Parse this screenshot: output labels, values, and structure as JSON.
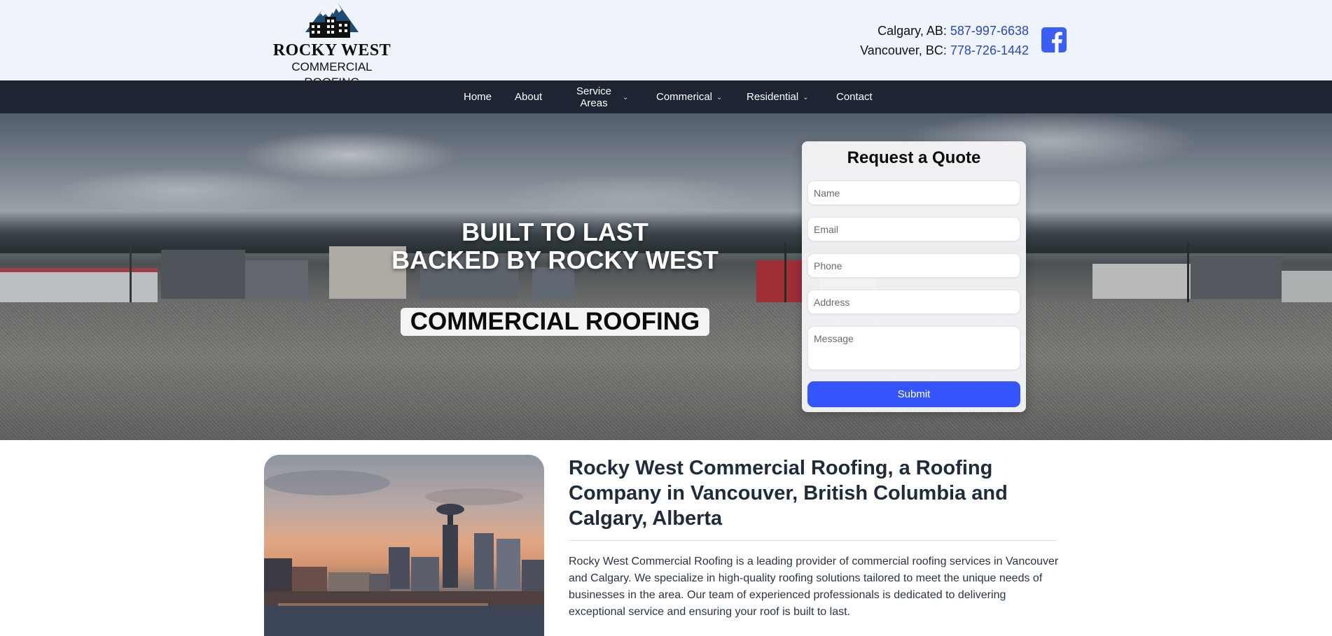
{
  "header": {
    "logo": {
      "name": "ROCKY WEST",
      "subtitle": "COMMERCIAL ROOFING"
    },
    "contacts": [
      {
        "label": "Calgary, AB:",
        "phone": "587-997-6638"
      },
      {
        "label": "Vancouver, BC:",
        "phone": "778-726-1442"
      }
    ],
    "social_icon": "facebook-icon"
  },
  "nav": {
    "items": [
      {
        "label": "Home"
      },
      {
        "label": "About"
      },
      {
        "label_line1": "Service",
        "label_line2": "Areas",
        "dropdown": true
      },
      {
        "label": "Commerical",
        "dropdown": true
      },
      {
        "label": "Residential",
        "dropdown": true
      },
      {
        "label": "Contact"
      }
    ],
    "chevron": "⌄"
  },
  "hero": {
    "title_line1": "BUILT TO LAST",
    "title_line2": "BACKED BY ROCKY WEST",
    "badge": "COMMERCIAL ROOFING"
  },
  "quote_form": {
    "title": "Request a Quote",
    "placeholders": {
      "name": "Name",
      "email": "Email",
      "phone": "Phone",
      "address": "Address",
      "message": "Message"
    },
    "submit_label": "Submit"
  },
  "content": {
    "title": "Rocky West Commercial Roofing, a Roofing Company in Vancouver, British Columbia and Calgary, Alberta",
    "body": "Rocky West Commercial Roofing is a leading provider of commercial roofing services in Vancouver and Calgary. We specialize in high-quality roofing solutions tailored to meet the unique needs of businesses in the area. Our team of experienced professionals is dedicated to delivering exceptional service and ensuring your roof is built to last."
  },
  "colors": {
    "header_bg": "#eff3fc",
    "nav_bg": "#1e2532",
    "phone_link": "#2947b8",
    "accent_blue": "#3355fb",
    "facebook_blue": "#3b5ef6"
  }
}
